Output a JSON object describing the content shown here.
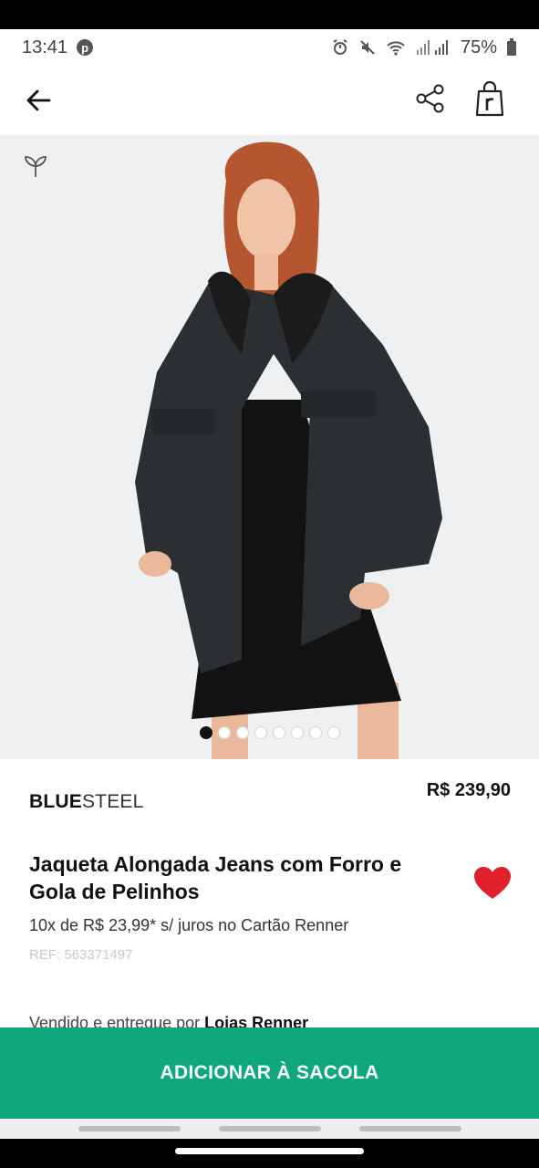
{
  "status": {
    "time": "13:41",
    "battery": "75%"
  },
  "product": {
    "brand_bold": "BLUE",
    "brand_thin": "STEEL",
    "price": "R$ 239,90",
    "title": "Jaqueta Alongada Jeans com Forro e Gola de Pelinhos",
    "installments": "10x de R$ 23,99* s/ juros no Cartão Renner",
    "ref": "REF: 563371497",
    "seller_prefix": "Vendido e entregue por ",
    "seller_name": "Lojas Renner"
  },
  "gallery": {
    "image_count": 8,
    "active_index": 0
  },
  "actions": {
    "add_to_bag": "ADICIONAR À SACOLA"
  },
  "colors": {
    "accent": "#0fa87a",
    "heart": "#e0202a"
  },
  "icons": [
    "pinterest-icon",
    "alarm-icon",
    "mute-icon",
    "wifi-icon",
    "signal-icon",
    "battery-icon",
    "back-arrow-icon",
    "share-icon",
    "shopping-bag-icon",
    "leaf-icon",
    "heart-icon"
  ]
}
